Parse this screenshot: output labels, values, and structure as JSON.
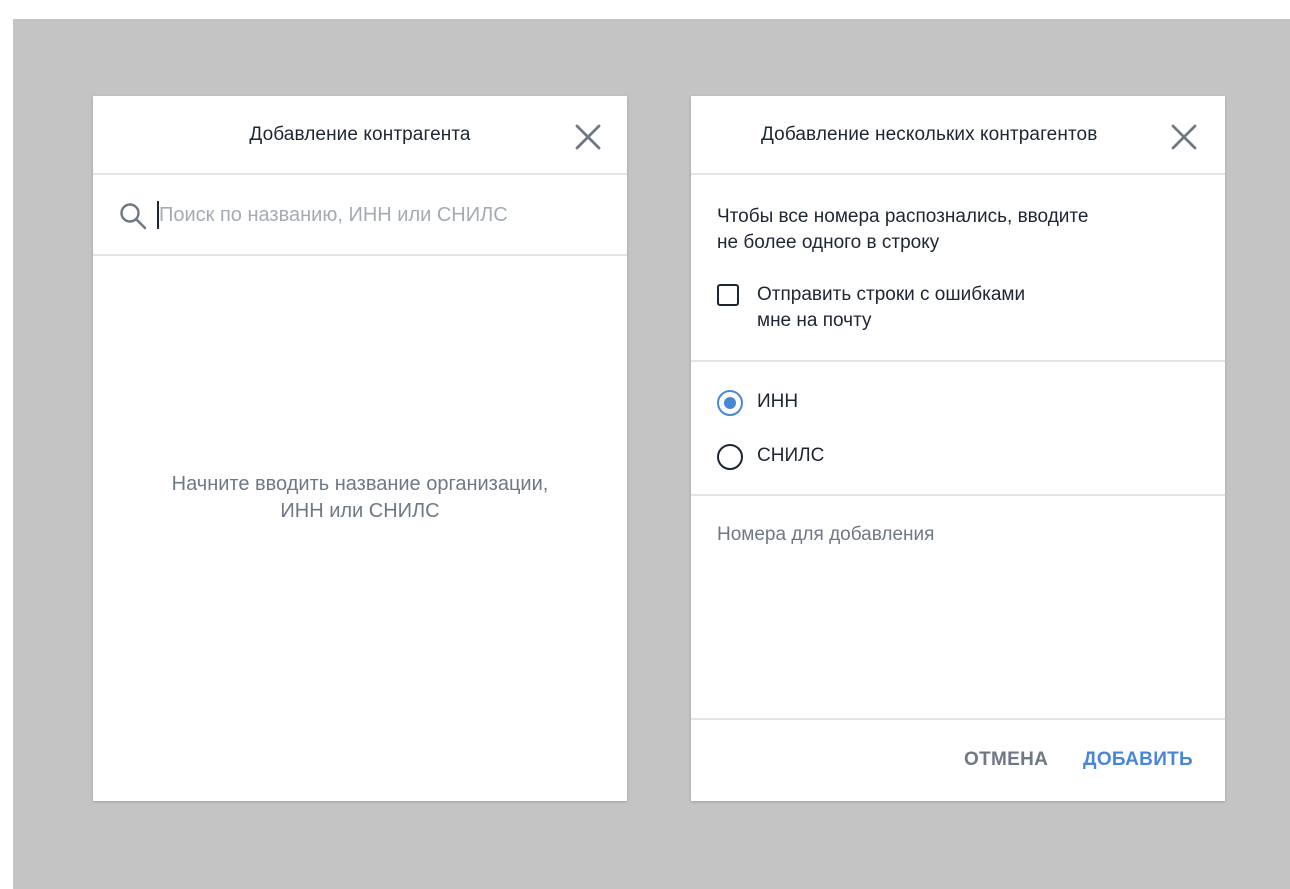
{
  "colors": {
    "accent": "#4a86d8",
    "text_primary": "#1e2633",
    "text_secondary": "#6f7885",
    "placeholder": "#a4abb4",
    "backdrop": "#c4c4c4",
    "divider": "#e3e5e8"
  },
  "single_dialog": {
    "title": "Добавление контрагента",
    "close_icon": "close-icon",
    "search": {
      "icon": "search-icon",
      "value": "",
      "placeholder": "Поиск по названию, ИНН или СНИЛС"
    },
    "empty_hint_line1": "Начните вводить название организации,",
    "empty_hint_line2": "ИНН или СНИЛС"
  },
  "multi_dialog": {
    "title": "Добавление нескольких контрагентов",
    "close_icon": "close-icon",
    "info_line1": "Чтобы все номера распознались, вводите",
    "info_line2": "не более одного в строку",
    "email_errors_checkbox": {
      "checked": false,
      "label_line1": "Отправить строки с ошибками",
      "label_line2": "мне на почту"
    },
    "id_type_options": [
      {
        "label": "ИНН",
        "selected": true
      },
      {
        "label": "СНИЛС",
        "selected": false
      }
    ],
    "numbers": {
      "value": "",
      "placeholder": "Номера для добавления"
    },
    "cancel_label": "ОТМЕНА",
    "add_label": "ДОБАВИТЬ"
  }
}
